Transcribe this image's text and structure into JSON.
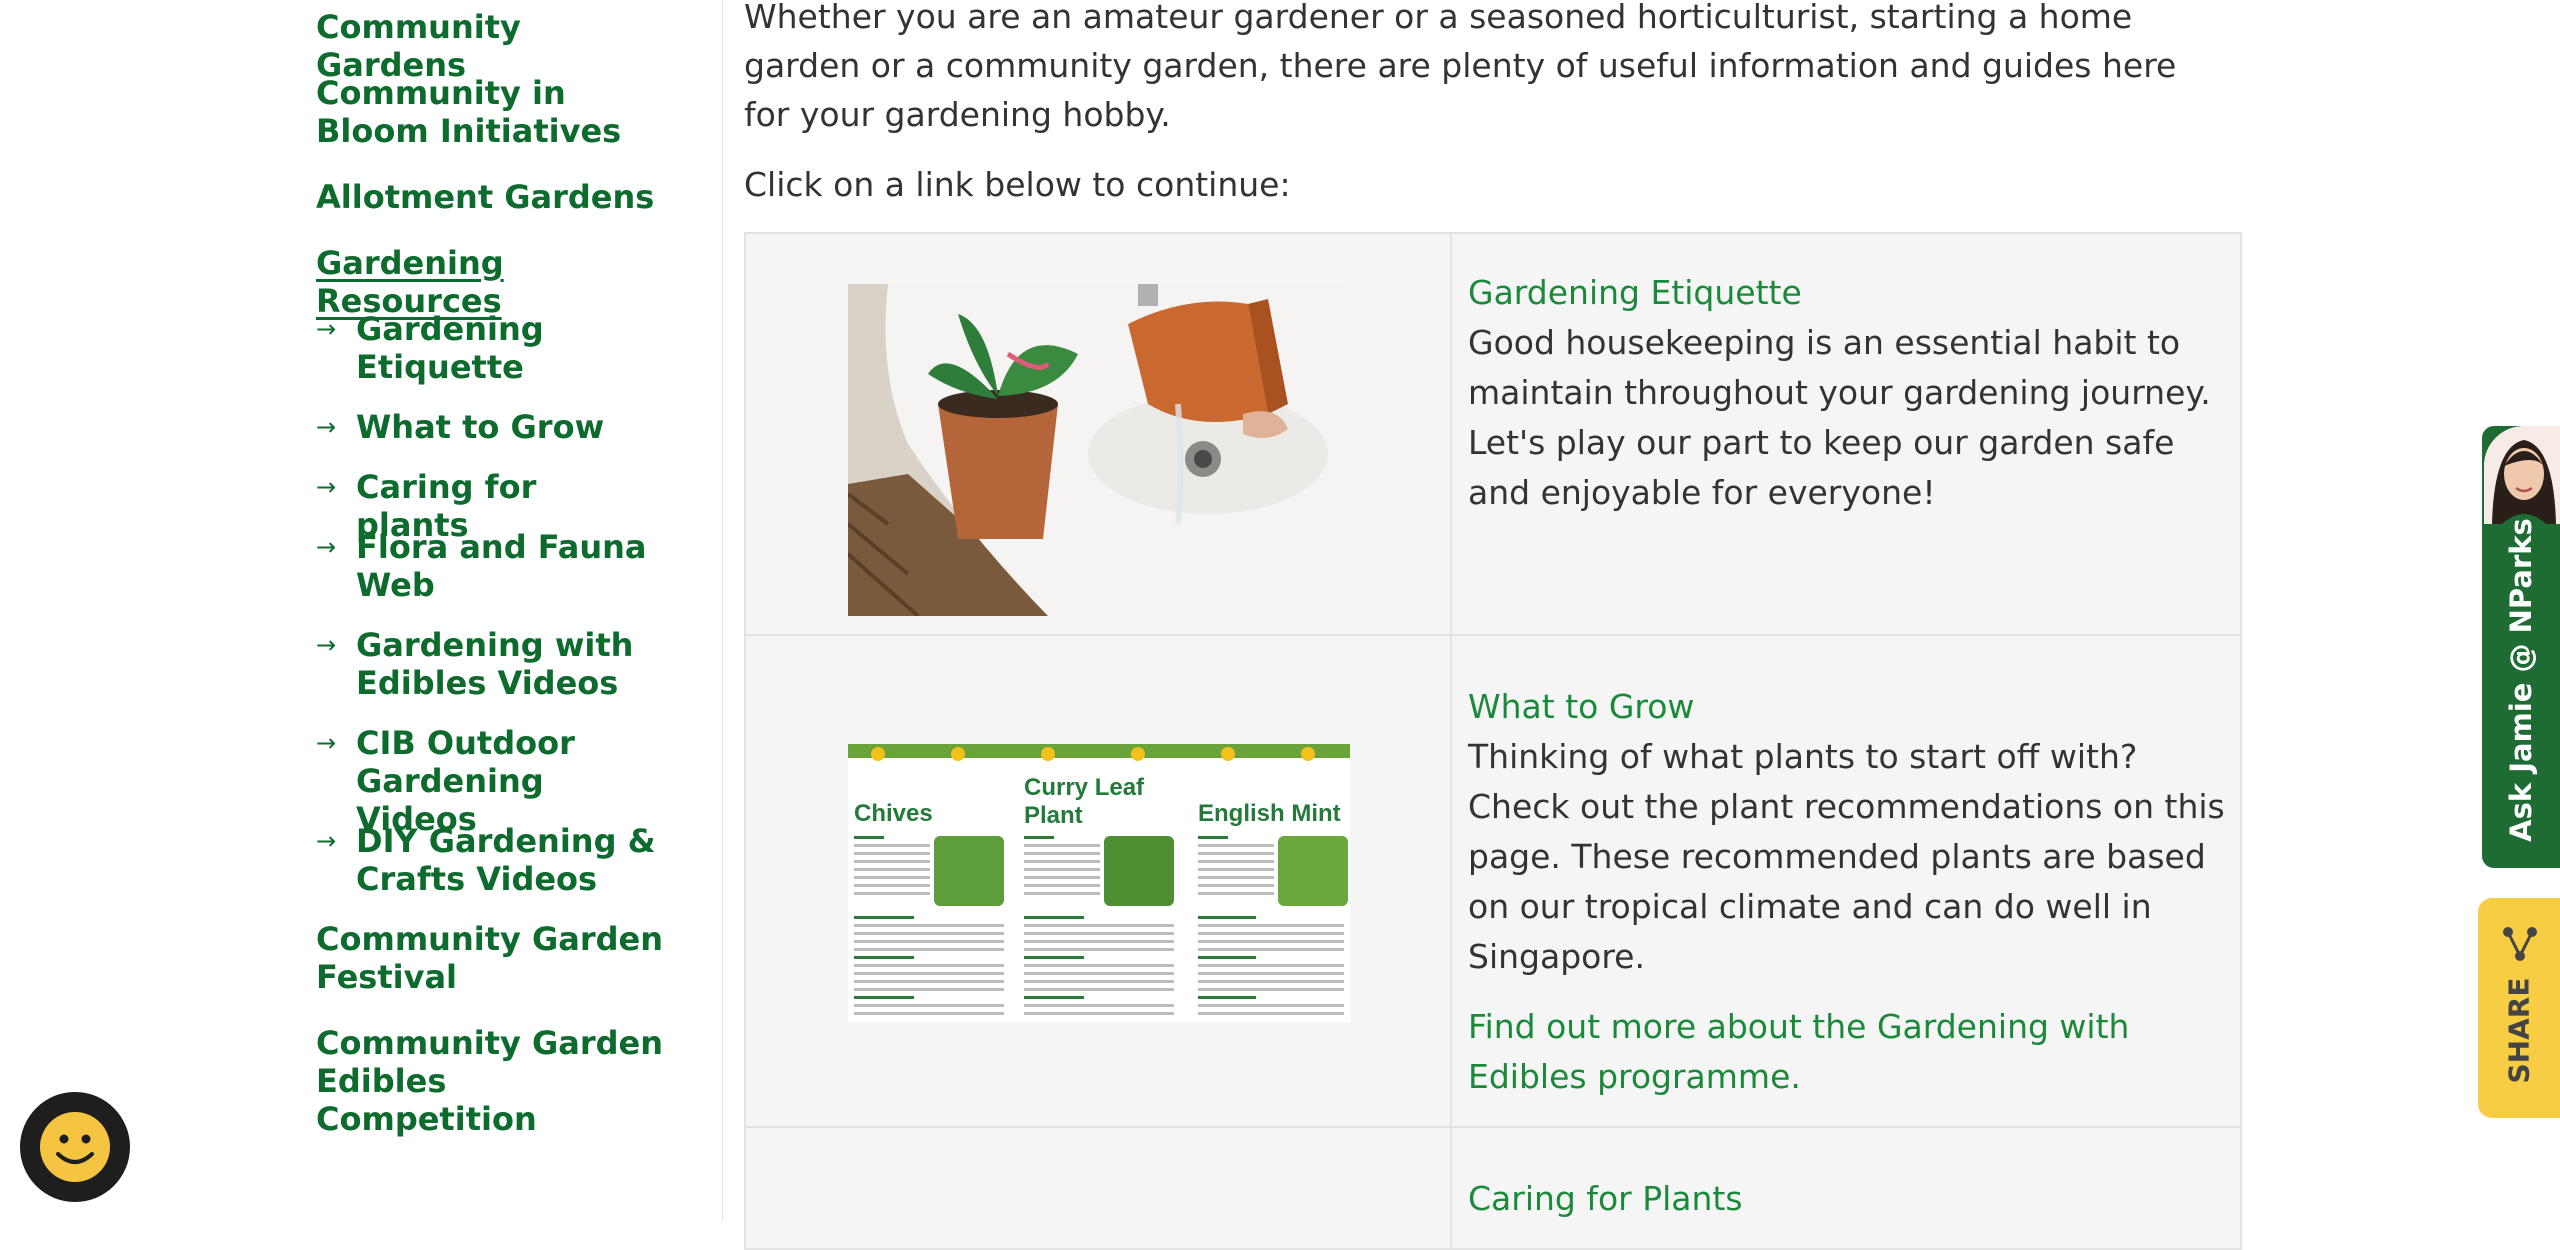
{
  "sidebar": {
    "items": [
      {
        "label": "Community Gardens"
      },
      {
        "label": "Community in Bloom Initiatives"
      },
      {
        "label": "Allotment Gardens"
      },
      {
        "label": "Gardening Resources"
      }
    ],
    "subitems": [
      {
        "label": "Gardening Etiquette"
      },
      {
        "label": "What to Grow"
      },
      {
        "label": "Caring for plants"
      },
      {
        "label": "Flora and Fauna Web"
      },
      {
        "label": "Gardening with Edibles Videos"
      },
      {
        "label": "CIB Outdoor Gardening Videos"
      },
      {
        "label": "DIY Gardening & Crafts Videos"
      }
    ],
    "after": [
      {
        "label": "Community Garden Festival"
      },
      {
        "label": "Community Garden Edibles Competition"
      }
    ],
    "arrow": "→"
  },
  "main": {
    "intro": "Whether you are an amateur gardener or a seasoned horticulturist, starting a home garden or a community garden, there are plenty of useful information and guides here for your gardening hobby.",
    "cta": "Click on a link below to continue:",
    "rows": [
      {
        "title": "Gardening Etiquette",
        "desc": "Good housekeeping is an essential habit to maintain throughout your gardening journey. Let's play our part to keep our garden safe and enjoyable for everyone!"
      },
      {
        "title": "What to Grow",
        "desc": "Thinking of what plants to start off with? Check out the plant recommendations on this page. These recommended plants are based on our tropical climate and can do well in Singapore.",
        "more": "Find out more about the Gardening with Edibles programme.",
        "poster": {
          "col1": "Chives",
          "col2": "Curry Leaf Plant",
          "col3": "English Mint"
        }
      },
      {
        "title": "Caring for Plants"
      }
    ]
  },
  "widgets": {
    "ask_jamie": "Ask Jamie @ NParks",
    "share": "SHARE",
    "feedback_icon": "smiley-face-icon"
  },
  "colors": {
    "nav_green": "#0d6b2e",
    "link_green": "#1a8a3a",
    "jamie_green": "#1e6b34",
    "share_yellow": "#f7ce43"
  }
}
